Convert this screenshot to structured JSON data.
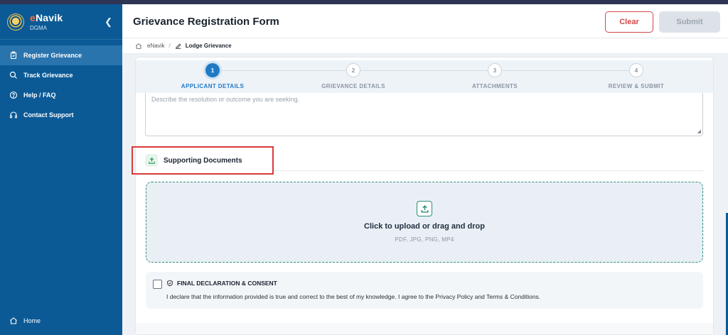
{
  "app": {
    "name_prefix": "e",
    "name_rest": "Navik",
    "subtitle": "DGMA"
  },
  "sidebar": {
    "items": [
      {
        "label": "Register Grievance",
        "icon": "clipboard-icon",
        "active": true
      },
      {
        "label": "Track Grievance",
        "icon": "search-icon",
        "active": false
      },
      {
        "label": "Help / FAQ",
        "icon": "help-circle-icon",
        "active": false
      },
      {
        "label": "Contact Support",
        "icon": "headset-icon",
        "active": false
      }
    ],
    "home_label": "Home"
  },
  "header": {
    "title": "Grievance Registration Form",
    "clear_label": "Clear",
    "submit_label": "Submit"
  },
  "breadcrumb": {
    "root": "eNavik",
    "separator": "/",
    "current": "Lodge Grievance"
  },
  "stepper": {
    "steps": [
      {
        "num": "1",
        "label": "APPLICANT DETAILS",
        "active": true
      },
      {
        "num": "2",
        "label": "GRIEVANCE DETAILS",
        "active": false
      },
      {
        "num": "3",
        "label": "ATTACHMENTS",
        "active": false
      },
      {
        "num": "4",
        "label": "REVIEW & SUBMIT",
        "active": false
      }
    ]
  },
  "resolution": {
    "placeholder": "Describe the resolution or outcome you are seeking."
  },
  "supporting_docs": {
    "title": "Supporting Documents",
    "upload_main": "Click to upload or drag and drop",
    "upload_formats": "PDF, JPG, PNG, MP4"
  },
  "declaration": {
    "title": "FINAL DECLARATION & CONSENT",
    "text": "I declare that the information provided is true and correct to the best of my knowledge. I agree to the Privacy Policy and Terms & Conditions.",
    "checked": false
  },
  "colors": {
    "sidebar": "#0b5a96",
    "accent": "#1f7ac4",
    "danger": "#d04848",
    "upload_border": "#2f8f7f"
  }
}
